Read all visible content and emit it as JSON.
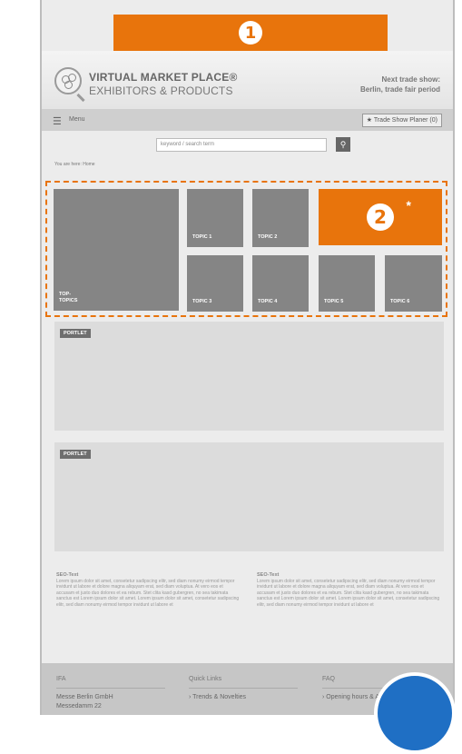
{
  "colors": {
    "accent": "#e8740c",
    "tile": "#858585",
    "portlet": "#dcdcdc",
    "badge": "#1f6fc4"
  },
  "banner": {
    "number": "1"
  },
  "brand": {
    "line1": "VIRTUAL MARKET PLACE®",
    "line2": "EXHIBITORS & PRODUCTS",
    "logo_icon": "people-magnifier-icon"
  },
  "next_show": {
    "line1": "Next trade show:",
    "line2": "Berlin, trade fair period"
  },
  "menubar": {
    "menu_icon": "hamburger-icon",
    "menu_label": "Menu",
    "planner_label": "★ Trade Show Planer (0)"
  },
  "search": {
    "placeholder": "keyword / search term",
    "button_icon": "search-icon"
  },
  "breadcrumb": "You are here:  Home",
  "topics": {
    "top_topics": "TOP-\nTOPICS",
    "items": [
      "TOPIC 1",
      "TOPIC 2",
      "TOPIC 3",
      "TOPIC 4",
      "TOPIC 5",
      "TOPIC 6"
    ],
    "highlight_number": "2",
    "highlight_mark": "*"
  },
  "portlets": [
    "PORTLET",
    "PORTLET"
  ],
  "seo": [
    {
      "title": "SEO-Text",
      "body": "Lorem ipsum dolor sit amet, consetetur sadipscing elitr, sed diam nonumy eirmod tempor invidunt ut labore et dolore magna aliquyam erat, sed diam voluptua. At vero eos et accusam et justo duo dolores et ea rebum. Stet clita kasd gubergren, no sea takimata sanctus est Lorem ipsum dolor sit amet. Lorem ipsum dolor sit amet, consetetur sadipscing elitr, sed diam nonumy eirmod tempor invidunt ut labore et"
    },
    {
      "title": "SEO-Text",
      "body": "Lorem ipsum dolor sit amet, consetetur sadipscing elitr, sed diam nonumy eirmod tempor invidunt ut labore et dolore magna aliquyam erat, sed diam voluptua. At vero eos et accusam et justo duo dolores et ea rebum. Stet clita kasd gubergren, no sea takimata sanctus est Lorem ipsum dolor sit amet. Lorem ipsum dolor sit amet, consetetur sadipscing elitr, sed diam nonumy eirmod tempor invidunt ut labore et"
    }
  ],
  "footer": {
    "col1": {
      "heading": "IFA",
      "items": [
        "Messe Berlin GmbH",
        "Messedamm 22"
      ]
    },
    "col2": {
      "heading": "Quick Links",
      "items": [
        "› Trends & Novelties"
      ]
    },
    "col3": {
      "heading": "FAQ",
      "items": [
        "› Opening hours & Admi"
      ]
    }
  }
}
